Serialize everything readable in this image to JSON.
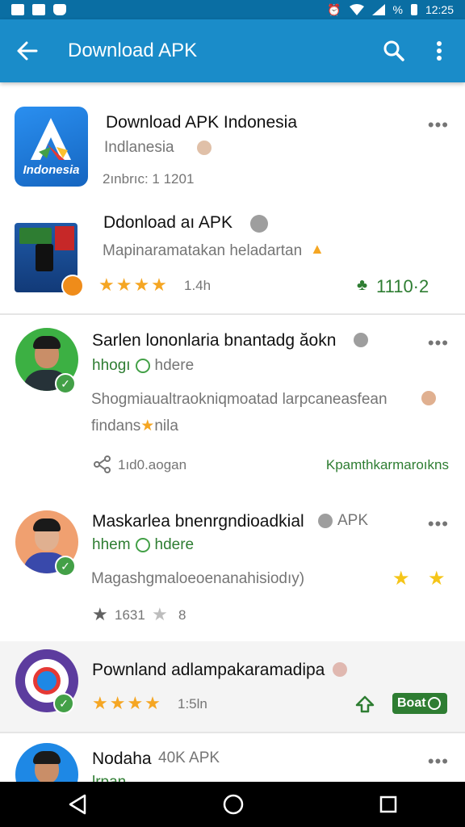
{
  "status_bar": {
    "time": "12:25",
    "battery": "%"
  },
  "app_bar": {
    "title": "Download APK"
  },
  "items": [
    {
      "title": "Download APK Indonesia",
      "subtitle": "Indlanesia",
      "meta": "2ınbrıc: 1  1201",
      "icon_label": "Indonesia"
    },
    {
      "title": "Ddonload aı APK",
      "subtitle": "Mapinaramatakan heladartan",
      "stars": "★★★★",
      "rating": "1.4h",
      "count": "1110·2"
    },
    {
      "title": "Sarlen lononlaria bnantadg ăokn",
      "dev": "hhogı",
      "dev2": "hdere",
      "desc_line1": "Shogmiaualtraokniqmoatad larpcaneasfean",
      "desc_line2": "findans",
      "desc_line2b": "nila",
      "share_label": "1ıd0.aogan",
      "link": "Kpamthkarmaroıkns"
    },
    {
      "title": "Maskarlea bnenrgndioadkial",
      "tag": "APK",
      "dev": "hhem",
      "dev2": "hdere",
      "desc": "Magashgmaloeoenanahisiodıy)",
      "rating": "1631",
      "rating2": "8"
    },
    {
      "title": "Pownland adlampakaramadipa",
      "stars": "★★★★",
      "rating": "1:5ln",
      "button": "Boat"
    },
    {
      "title": "Nodaha",
      "tag": "40K APK",
      "dev": "lrpan"
    }
  ],
  "colors": {
    "app_bar": "#1a8cc9",
    "status_bar": "#0a6ea3",
    "accent_green": "#2e7d32",
    "star": "#f5a623"
  }
}
